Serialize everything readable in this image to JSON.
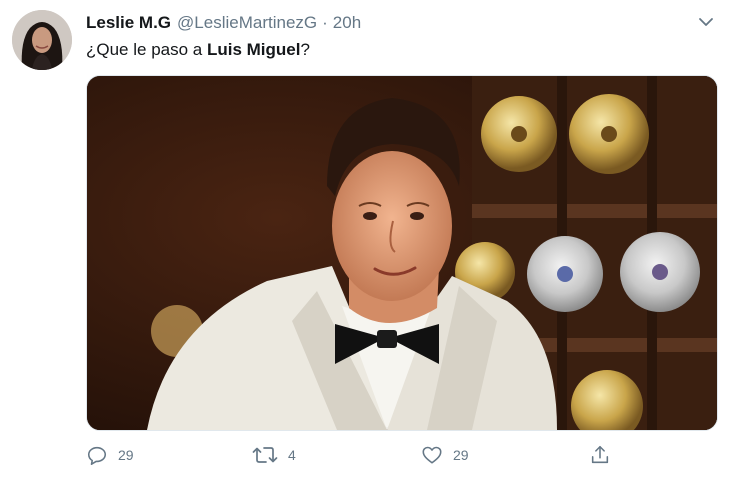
{
  "tweet": {
    "author_name": "Leslie M.G",
    "author_handle": "@LeslieMartinezG",
    "separator": "·",
    "time": "20h",
    "text_prefix": "¿Que le paso a ",
    "text_bold": "Luis Miguel",
    "text_suffix": "?"
  },
  "actions": {
    "reply_count": "29",
    "retweet_count": "4",
    "like_count": "29"
  },
  "icons": {
    "caret": "chevron-down-icon",
    "reply": "reply-icon",
    "retweet": "retweet-icon",
    "like": "heart-icon",
    "share": "share-icon"
  },
  "colors": {
    "text_primary": "#14171a",
    "text_secondary": "#657786",
    "border": "#e1e8ed"
  }
}
